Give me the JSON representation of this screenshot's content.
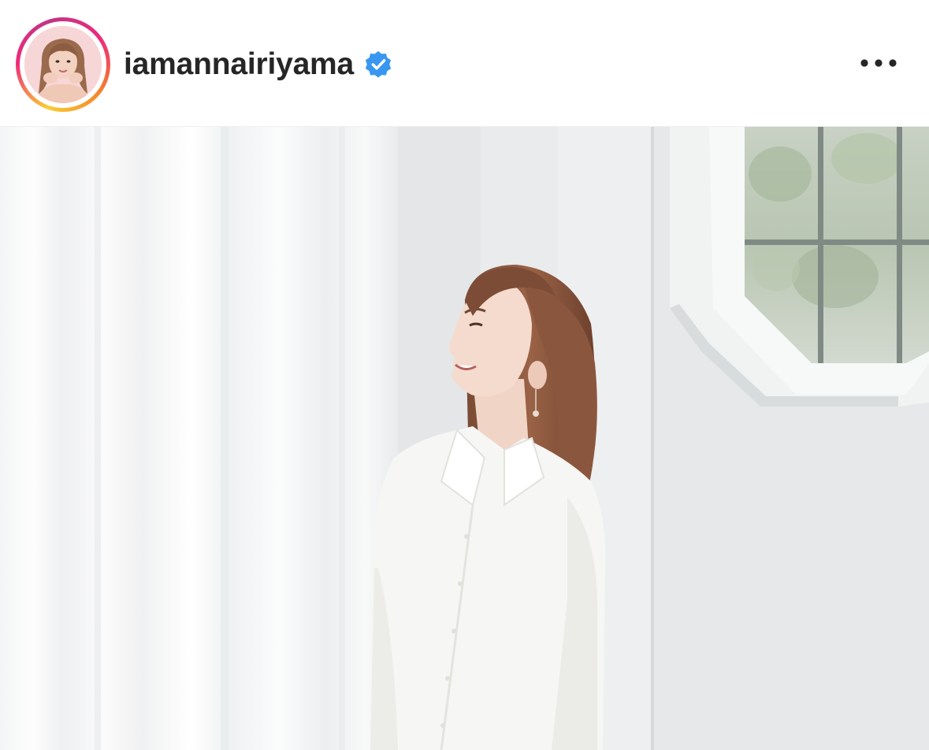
{
  "post": {
    "header": {
      "username": "iamannairiyama",
      "verified": true,
      "verified_icon": "verified-badge-icon",
      "more_icon": "more-horizontal-icon"
    },
    "photo": {
      "avatar_alt_icon": "profile-photo",
      "content_icon": "post-photo"
    }
  },
  "colors": {
    "username": "#262626",
    "verified_blue": "#3897f0",
    "ring_yellow": "#f9ce34",
    "ring_pink": "#ee2a7b",
    "ring_purple": "#c13584",
    "background": "#ffffff"
  }
}
